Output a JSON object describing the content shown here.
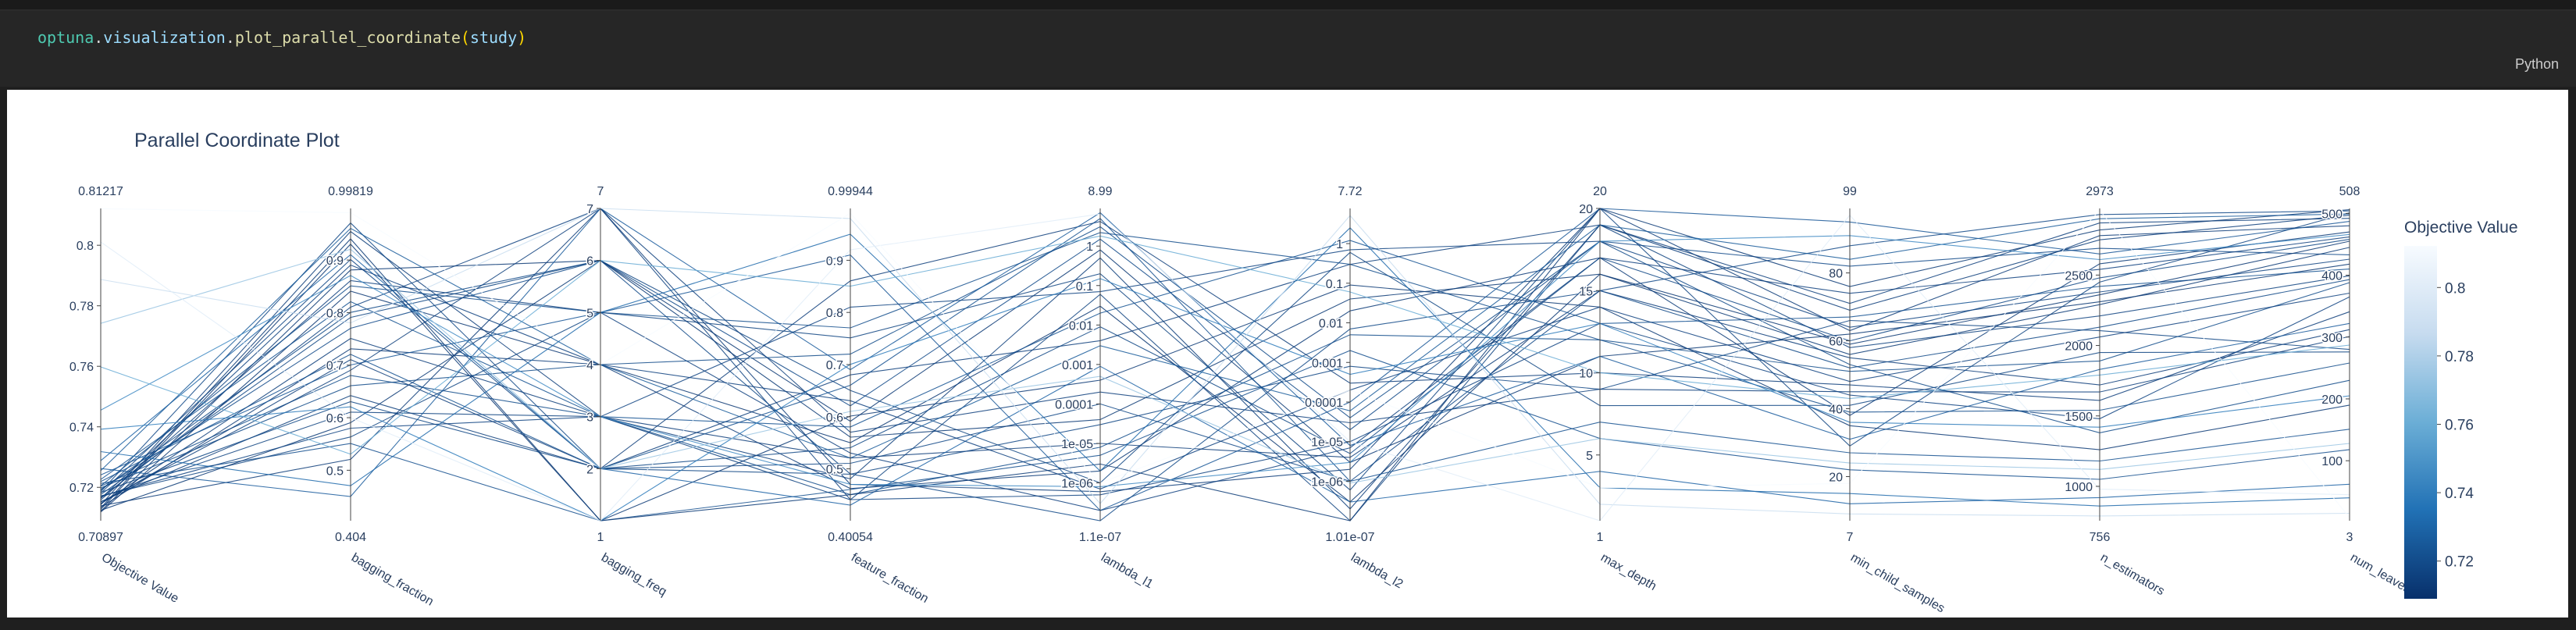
{
  "code": {
    "module": "optuna",
    "submodule": "visualization",
    "func": "plot_parallel_coordinate",
    "arg": "study"
  },
  "language": "Python",
  "chart_data": {
    "type": "parallel_coordinates",
    "title": "Parallel Coordinate Plot",
    "colorbar": {
      "title": "Objective Value",
      "ticks": [
        "0.8",
        "0.78",
        "0.76",
        "0.74",
        "0.72"
      ],
      "range": [
        0.70897,
        0.81217
      ]
    },
    "axes": [
      {
        "name": "Objective Value",
        "min": "0.70897",
        "max": "0.81217",
        "ticks": [
          "0.72",
          "0.74",
          "0.76",
          "0.78",
          "0.8"
        ]
      },
      {
        "name": "bagging_fraction",
        "min": "0.404",
        "max": "0.99819",
        "ticks": [
          "0.5",
          "0.6",
          "0.7",
          "0.8",
          "0.9"
        ]
      },
      {
        "name": "bagging_freq",
        "min": "1",
        "max": "7",
        "ticks": [
          "2",
          "3",
          "4",
          "5",
          "6",
          "7"
        ]
      },
      {
        "name": "feature_fraction",
        "min": "0.40054",
        "max": "0.99944",
        "ticks": [
          "0.5",
          "0.6",
          "0.7",
          "0.8",
          "0.9"
        ]
      },
      {
        "name": "lambda_l1",
        "min": "1.1e-07",
        "max": "8.99",
        "ticks": [
          "1e-06",
          "1e-05",
          "0.0001",
          "0.001",
          "0.01",
          "0.1",
          "1"
        ]
      },
      {
        "name": "lambda_l2",
        "min": "1.01e-07",
        "max": "7.72",
        "ticks": [
          "1e-06",
          "1e-05",
          "0.0001",
          "0.001",
          "0.01",
          "0.1",
          "1"
        ]
      },
      {
        "name": "max_depth",
        "min": "1",
        "max": "20",
        "ticks": [
          "5",
          "10",
          "15",
          "20"
        ]
      },
      {
        "name": "min_child_samples",
        "min": "7",
        "max": "99",
        "ticks": [
          "20",
          "40",
          "60",
          "80"
        ]
      },
      {
        "name": "n_estimators",
        "min": "756",
        "max": "2973",
        "ticks": [
          "1000",
          "1500",
          "2000",
          "2500"
        ]
      },
      {
        "name": "num_leaves",
        "min": "3",
        "max": "508",
        "ticks": [
          "100",
          "200",
          "300",
          "400",
          "500"
        ]
      }
    ],
    "trials": [
      [
        0.7121,
        0.8812,
        6,
        0.5912,
        0.8,
        3e-06,
        11,
        62,
        2310,
        418
      ],
      [
        0.7134,
        0.7311,
        4,
        0.4622,
        2e-06,
        0.02,
        17,
        38,
        2580,
        470
      ],
      [
        0.7142,
        0.9543,
        3,
        0.5207,
        1e-05,
        4e-06,
        15,
        55,
        1720,
        312
      ],
      [
        0.7153,
        0.6421,
        2,
        0.6803,
        0.004,
        0.3,
        19,
        71,
        2870,
        492
      ],
      [
        0.7165,
        0.8103,
        7,
        0.441,
        5e-07,
        1e-05,
        13,
        44,
        1480,
        365
      ],
      [
        0.7172,
        0.5634,
        5,
        0.7512,
        0.2,
        6e-07,
        20,
        29,
        2450,
        501
      ],
      [
        0.7181,
        0.9011,
        2,
        0.4898,
        3e-05,
        0.0008,
        9,
        66,
        2105,
        280
      ],
      [
        0.7193,
        0.7702,
        6,
        0.621,
        1.5,
        2e-05,
        18,
        82,
        2690,
        433
      ],
      [
        0.7204,
        0.6805,
        3,
        0.4507,
        8e-06,
        0.005,
        12,
        51,
        1890,
        388
      ],
      [
        0.7118,
        0.8407,
        4,
        0.5501,
        0.03,
        3e-07,
        16,
        59,
        2360,
        455
      ],
      [
        0.7127,
        0.9303,
        1,
        0.6012,
        0.0004,
        0.09,
        14,
        35,
        1260,
        190
      ],
      [
        0.7139,
        0.5208,
        7,
        0.4703,
        6e-07,
        2e-06,
        20,
        63,
        2780,
        480
      ],
      [
        0.7147,
        0.7106,
        2,
        0.8605,
        4.2,
        0.0003,
        10,
        47,
        1610,
        341
      ],
      [
        0.7158,
        0.8609,
        5,
        0.5303,
        2e-07,
        7e-06,
        17,
        74,
        2540,
        462
      ],
      [
        0.7168,
        0.6107,
        3,
        0.4406,
        0.06,
        0.0,
        19,
        58,
        2210,
        399
      ],
      [
        0.7176,
        0.7908,
        6,
        0.6505,
        1e-06,
        0.6,
        8,
        41,
        1950,
        276
      ],
      [
        0.7186,
        0.9705,
        2,
        0.5106,
        0.0001,
        1e-06,
        15,
        88,
        2930,
        504
      ],
      [
        0.7198,
        0.6608,
        4,
        0.7201,
        3.1,
        4e-05,
        18,
        53,
        1380,
        230
      ],
      [
        0.7213,
        0.5509,
        1,
        0.4605,
        5e-06,
        0.002,
        6,
        22,
        1050,
        118
      ],
      [
        0.7226,
        0.8208,
        3,
        0.5804,
        0.02,
        1.2,
        13,
        67,
        2420,
        410
      ],
      [
        0.7241,
        0.7004,
        5,
        0.9102,
        2e-07,
        0.0001,
        20,
        95,
        2650,
        487
      ],
      [
        0.7262,
        0.4501,
        7,
        0.6901,
        7.0,
        8e-06,
        11,
        31,
        1830,
        322
      ],
      [
        0.7288,
        0.9102,
        2,
        0.4305,
        0.0009,
        3e-07,
        4,
        12,
        920,
        62
      ],
      [
        0.7124,
        0.5906,
        6,
        0.5608,
        4e-05,
        0.04,
        16,
        56,
        2290,
        445
      ],
      [
        0.7145,
        0.7508,
        3,
        0.4808,
        0.5,
        2e-07,
        19,
        69,
        2750,
        497
      ],
      [
        0.7163,
        0.8905,
        4,
        0.6306,
        7e-07,
        0.0002,
        14,
        48,
        2060,
        371
      ],
      [
        0.7183,
        0.6305,
        2,
        0.5405,
        0.009,
        5e-06,
        17,
        60,
        2480,
        458
      ],
      [
        0.7205,
        0.8509,
        5,
        0.7704,
        2.2,
        0.3,
        12,
        39,
        1540,
        258
      ],
      [
        0.7132,
        0.9402,
        1,
        0.4504,
        3e-06,
        0.0,
        20,
        76,
        2820,
        506
      ],
      [
        0.7151,
        0.6904,
        7,
        0.5702,
        0.0002,
        3e-05,
        9,
        45,
        1670,
        301
      ],
      [
        0.7171,
        0.5801,
        3,
        0.8102,
        0.07,
        0.7,
        18,
        64,
        2380,
        426
      ],
      [
        0.7191,
        0.8003,
        6,
        0.4903,
        1e-07,
        0.007,
        15,
        52,
        2130,
        393
      ],
      [
        0.7219,
        0.7205,
        2,
        0.6603,
        5.0,
        1e-06,
        7,
        27,
        1180,
        151
      ],
      [
        0.7255,
        0.9603,
        4,
        0.5206,
        0.003,
        6e-05,
        19,
        84,
        2900,
        499
      ],
      [
        0.7318,
        0.4705,
        5,
        0.9501,
        2e-06,
        2.5,
        3,
        15,
        860,
        40
      ],
      [
        0.7392,
        0.6207,
        1,
        0.7003,
        0.15,
        0.0005,
        13,
        36,
        1420,
        205
      ],
      [
        0.7455,
        0.8706,
        3,
        0.4703,
        8e-07,
        3e-06,
        18,
        91,
        2610,
        466
      ],
      [
        0.7598,
        0.5305,
        6,
        0.8503,
        1.8,
        0.06,
        10,
        43,
        1790,
        287
      ],
      [
        0.7742,
        0.9205,
        2,
        0.6102,
        0.0005,
        9e-07,
        6,
        24,
        1120,
        128
      ],
      [
        0.7887,
        0.7804,
        7,
        0.9801,
        3e-07,
        5.1,
        2,
        9,
        790,
        15
      ],
      [
        0.8011,
        0.6003,
        1,
        0.9201,
        6.5,
        1e-05,
        1,
        97,
        980,
        45
      ],
      [
        0.8121,
        0.9901,
        4,
        0.9901,
        1e-06,
        0.0002,
        3,
        18,
        2960,
        8
      ]
    ]
  }
}
